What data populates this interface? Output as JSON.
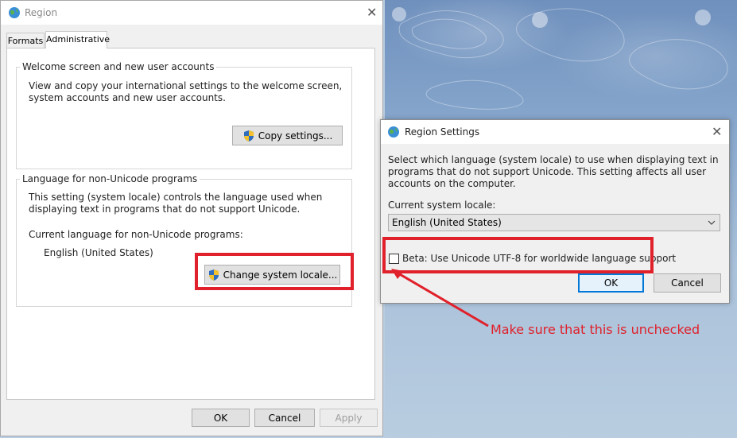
{
  "region_window": {
    "title": "Region",
    "close_glyph": "✕",
    "tabs": [
      {
        "label": "Formats",
        "active": false
      },
      {
        "label": "Administrative",
        "active": true
      }
    ],
    "welcome_group": {
      "legend": "Welcome screen and new user accounts",
      "description": "View and copy your international settings to the welcome screen, system accounts and new user accounts.",
      "copy_button": "Copy settings..."
    },
    "nonunicode_group": {
      "legend": "Language for non-Unicode programs",
      "description": "This setting (system locale) controls the language used when displaying text in programs that do not support Unicode.",
      "current_label": "Current language for non-Unicode programs:",
      "current_value": "English (United States)",
      "change_button": "Change system locale..."
    },
    "footer": {
      "ok": "OK",
      "cancel": "Cancel",
      "apply": "Apply"
    }
  },
  "settings_dialog": {
    "title": "Region Settings",
    "close_glyph": "✕",
    "description": "Select which language (system locale) to use when displaying text in programs that do not support Unicode. This setting affects all user accounts on the computer.",
    "locale_label": "Current system locale:",
    "locale_value": "English (United States)",
    "beta_checkbox_label": "Beta: Use Unicode UTF-8 for worldwide language support",
    "beta_checked": false,
    "ok": "OK",
    "cancel": "Cancel"
  },
  "annotation": {
    "text": "Make sure that this is unchecked",
    "color": "#e0202a"
  },
  "colors": {
    "accent": "#0078d7",
    "highlight_red": "#e0202a",
    "window_bg": "#f0f0f0"
  },
  "icons": [
    "globe-icon",
    "close-icon",
    "uac-shield-icon",
    "chevron-down-icon"
  ]
}
